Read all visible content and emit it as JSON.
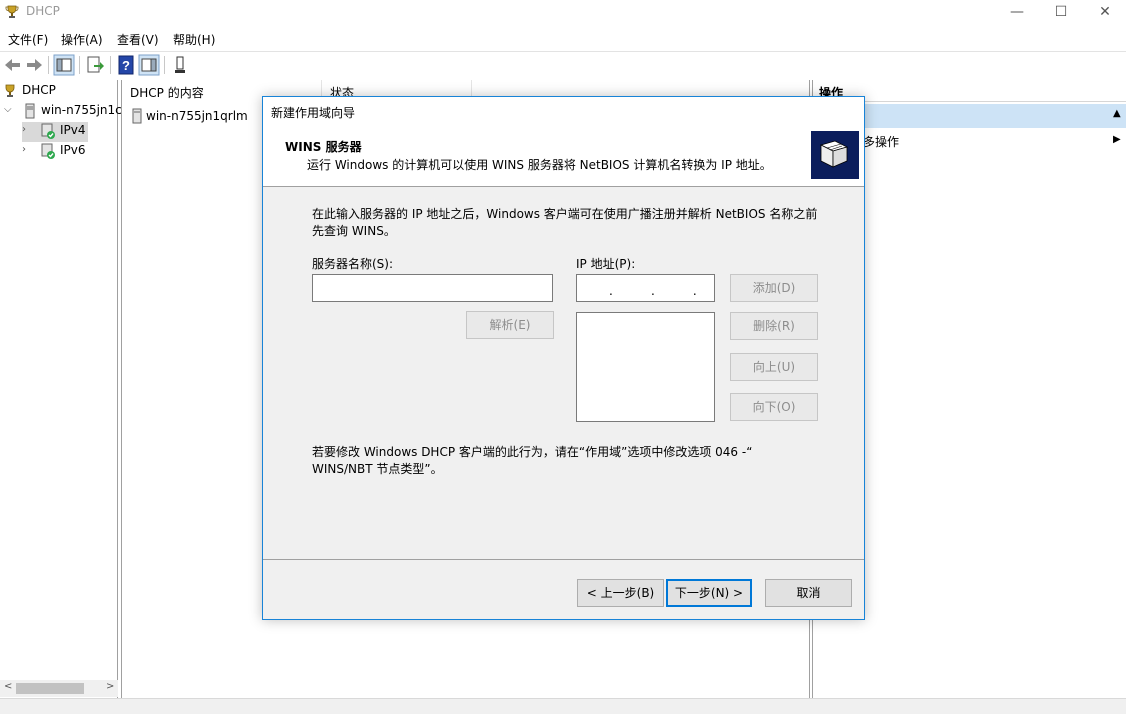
{
  "window": {
    "title": "DHCP",
    "minimize_glyph": "—",
    "maximize_glyph": "☐",
    "close_glyph": "✕"
  },
  "menu": [
    {
      "label": "文件(F)"
    },
    {
      "label": "操作(A)"
    },
    {
      "label": "查看(V)"
    },
    {
      "label": "帮助(H)"
    }
  ],
  "toolbar": {
    "icons": [
      "back-arrow-icon",
      "forward-arrow-icon",
      "show-hide-console-tree-icon",
      "export-list-icon",
      "help-icon",
      "show-hide-action-pane-icon",
      "server-status-icon"
    ]
  },
  "tree": {
    "root": "DHCP",
    "server": "win-n755jn1c",
    "ipv4": "IPv4",
    "ipv6": "IPv6"
  },
  "content": {
    "col1": "DHCP 的内容",
    "col2": "状态",
    "row_name": "win-n755jn1qrlm"
  },
  "actions": {
    "header": "操作",
    "more": "多操作"
  },
  "dialog": {
    "title": "新建作用域向导",
    "banner_title": "WINS 服务器",
    "banner_sub": "运行 Windows 的计算机可以使用 WINS 服务器将 NetBIOS 计算机名转换为 IP 地址。",
    "intro_line1": "在此输入服务器的 IP 地址之后，Windows 客户端可在使用广播注册并解析 NetBIOS 名称之前",
    "intro_line2": "先查询 WINS。",
    "server_name_label": "服务器名称(S):",
    "server_name_value": "",
    "ip_label": "IP 地址(P):",
    "ip_dots": ".          .          .",
    "resolve_button": "解析(E)",
    "add_button": "添加(D)",
    "remove_button": "删除(R)",
    "up_button": "向上(U)",
    "down_button": "向下(O)",
    "note_line1": "若要修改 Windows DHCP 客户端的此行为，请在“作用域”选项中修改选项 046 -“",
    "note_line2": "WINS/NBT 节点类型”。",
    "back_button": "< 上一步(B)",
    "next_button": "下一步(N) >",
    "cancel_button": "取消"
  },
  "colors": {
    "accent": "#0078d7",
    "dialog_border": "#1883d7",
    "selection": "#cde3f6",
    "banner_image": "#0b1d5c"
  }
}
